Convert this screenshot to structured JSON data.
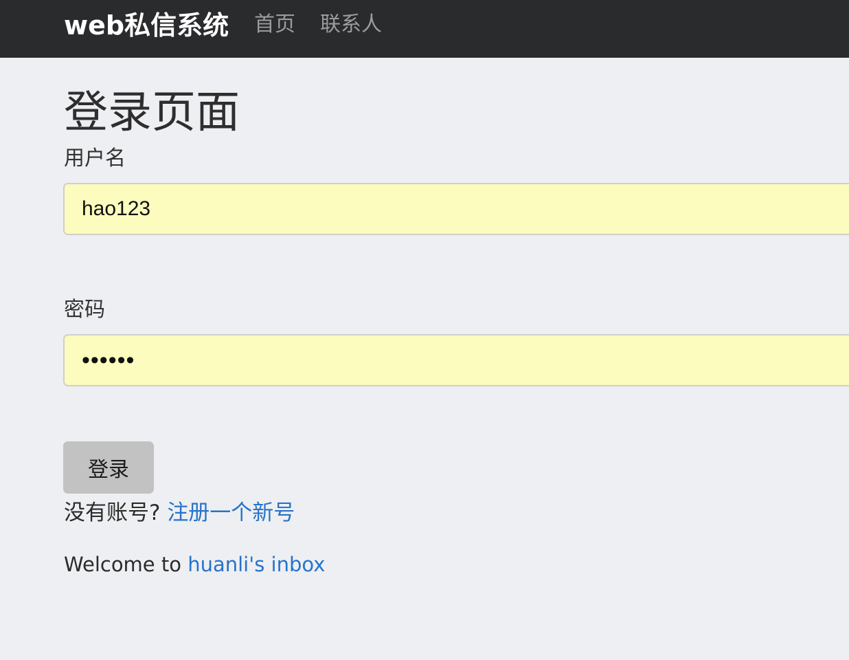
{
  "navbar": {
    "brand": "web私信系统",
    "links": [
      {
        "label": "首页"
      },
      {
        "label": "联系人"
      }
    ]
  },
  "page": {
    "title": "登录页面"
  },
  "form": {
    "username_label": "用户名",
    "username_value": "hao123",
    "password_label": "密码",
    "password_value": "••••••",
    "login_label": "登录"
  },
  "register": {
    "prompt": "没有账号? ",
    "link_label": "注册一个新号"
  },
  "footer": {
    "welcome_prefix": "Welcome to ",
    "welcome_link": "huanli's inbox"
  },
  "colors": {
    "navbar_bg": "#2a2b2d",
    "page_bg": "#eeeff2",
    "input_bg": "#fbfcbd",
    "link": "#2773c9",
    "button_bg": "#c2c2c2"
  }
}
